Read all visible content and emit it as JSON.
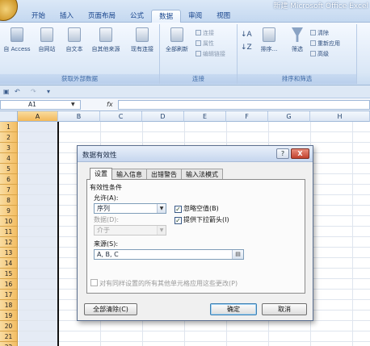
{
  "window": {
    "title": "新建 Microsoft Office Excel"
  },
  "tabs": [
    {
      "label": "开始",
      "active": false
    },
    {
      "label": "插入",
      "active": false
    },
    {
      "label": "页面布局",
      "active": false
    },
    {
      "label": "公式",
      "active": false
    },
    {
      "label": "数据",
      "active": true
    },
    {
      "label": "审阅",
      "active": false
    },
    {
      "label": "视图",
      "active": false
    }
  ],
  "ribbon": {
    "external": {
      "label": "获取外部数据",
      "access": "自 Access",
      "web": "自网站",
      "text": "自文本",
      "other": "自其他来源",
      "existing": "现有连接"
    },
    "connections": {
      "label": "连接",
      "refresh_all": "全部刷新",
      "connections": "连接",
      "properties": "属性",
      "edit_links": "编辑链接"
    },
    "sort_filter": {
      "label": "排序和筛选",
      "sort": "排序...",
      "filter": "筛选",
      "clear": "清除",
      "reapply": "重新应用",
      "advanced": "高级"
    }
  },
  "formula_bar": {
    "cell_ref": "A1",
    "fx": "fx"
  },
  "grid": {
    "columns": [
      "A",
      "B",
      "C",
      "D",
      "E",
      "F",
      "G",
      "H"
    ],
    "rows": [
      "1",
      "2",
      "3",
      "4",
      "5",
      "6",
      "7",
      "8",
      "9",
      "10",
      "11",
      "12",
      "13",
      "14",
      "15",
      "16",
      "17",
      "18",
      "19",
      "20",
      "21",
      "22"
    ]
  },
  "dialog": {
    "title": "数据有效性",
    "help": "?",
    "close": "X",
    "tabs": [
      "设置",
      "输入信息",
      "出错警告",
      "输入法模式"
    ],
    "criteria_label": "有效性条件",
    "allow_label": "允许(A):",
    "allow_value": "序列",
    "data_label": "数据(D):",
    "data_value": "介于",
    "ignore_blank": "忽略空值(B)",
    "dropdown": "提供下拉箭头(I)",
    "source_label": "来源(S):",
    "source_value": "A, B, C",
    "apply_all": "对有同样设置的所有其他单元格应用这些更改(P)",
    "clear_all": "全部清除(C)",
    "ok": "确定",
    "cancel": "取消"
  },
  "colors": {
    "accent": "#15428b",
    "row_header": "#f3bd63",
    "selection": "#e5ebf5"
  }
}
